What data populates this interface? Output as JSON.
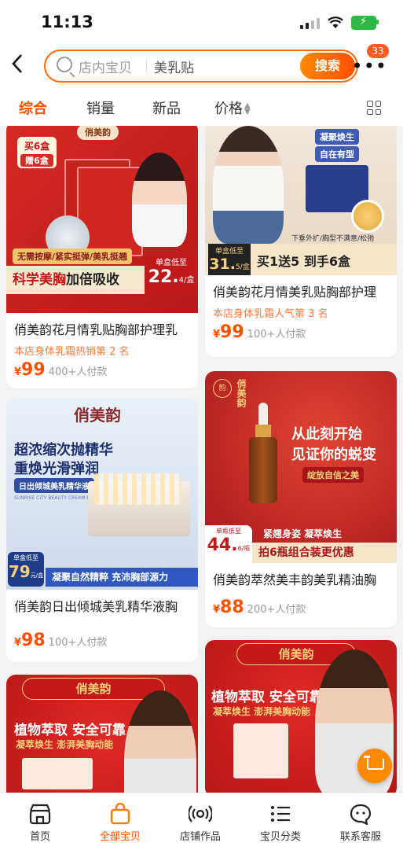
{
  "status": {
    "time": "11:13"
  },
  "search": {
    "scope": "店内宝贝",
    "query": "美乳贴",
    "button": "搜索",
    "badge": "33"
  },
  "tabs": [
    {
      "label": "综合",
      "active": true
    },
    {
      "label": "销量",
      "active": false
    },
    {
      "label": "新品",
      "active": false
    },
    {
      "label": "价格",
      "active": false
    }
  ],
  "products": [
    {
      "title": "俏美韵花月情乳贴胸部护理乳",
      "rank": "本店身体乳霜热销第 2 名",
      "yen": "¥",
      "price": "99",
      "sold": "400+人付款",
      "img": {
        "badge_top": "买6盒",
        "badge_bottom": "赠6盒",
        "sub": "无需按摩/紧实挺弹/美乳挺翘",
        "headline": "科学美胸",
        "headline2": "加倍吸收",
        "unit_label": "单盒低至",
        "unit_price": "22.",
        "unit_suffix": "4/盒",
        "brand": "俏美韵"
      }
    },
    {
      "title": "俏美韵花月情美乳贴胸部护理",
      "rank": "本店身体乳霜人气第 3 名",
      "yen": "¥",
      "price": "99",
      "sold": "100+人付款",
      "img": {
        "tag1": "凝聚焕生",
        "tag2": "自在有型",
        "strip": "下垂外扩/胸型不满意/松弛",
        "unit_label": "单盒低至",
        "unit_price": "31.",
        "unit_suffix": "5/盒",
        "offer": "买1送5 到手6盒"
      }
    },
    {
      "title": "俏美韵日出倾城美乳精华液胸",
      "rank": "",
      "yen": "¥",
      "price": "98",
      "sold": "100+人付款",
      "img": {
        "brand": "俏美韵",
        "line1": "超浓缩次抛精华",
        "line2": "重焕光滑弹润",
        "pill": "日出倾城美乳精华液",
        "en": "SUNRISE CITY BEAUTY CREAM ESSENCE",
        "unit_label": "单盒低至",
        "unit_price": "79",
        "unit_suffix": "元/盒",
        "footer": "凝聚自然精粹 充沛胸部源力"
      }
    },
    {
      "title": "俏美韵萃然美丰韵美乳精油胸",
      "rank": "",
      "yen": "¥",
      "price": "88",
      "sold": "200+人付款",
      "img": {
        "brand": "俏美韵",
        "line1": "从此刻开始",
        "line2": "见证你的蜕变",
        "pill": "绽放自信之美",
        "sub": "紧翘身姿 凝萃焕生",
        "unit_label": "单瓶低至",
        "unit_price": "44.",
        "unit_suffix": "6/瓶",
        "offer": "拍6瓶组合装更优惠"
      }
    },
    {
      "img": {
        "brand": "俏美韵",
        "headline": "植物萃取 安全可靠",
        "sub": "凝萃焕生 澎湃美胸动能"
      }
    },
    {
      "img": {
        "brand": "俏美韵",
        "headline": "植物萃取 安全可靠",
        "sub": "凝萃焕生 澎湃美胸动能"
      }
    }
  ],
  "bottom_nav": [
    {
      "label": "首页",
      "icon": "home-icon",
      "active": false
    },
    {
      "label": "全部宝贝",
      "icon": "bag-icon",
      "active": true
    },
    {
      "label": "店铺作品",
      "icon": "live-icon",
      "active": false
    },
    {
      "label": "宝贝分类",
      "icon": "list-icon",
      "active": false
    },
    {
      "label": "联系客服",
      "icon": "chat-icon",
      "active": false
    }
  ],
  "colors": {
    "accent": "#ff5000",
    "price": "#ff5000",
    "rank": "#ff7a3c"
  }
}
